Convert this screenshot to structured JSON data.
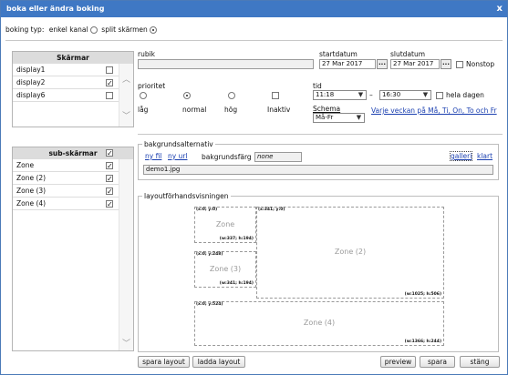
{
  "window": {
    "title": "boka eller ändra boking",
    "close": "x"
  },
  "booking_type": {
    "label": "boking typ:",
    "opt1": "enkel kanal",
    "opt2": "split skärmen"
  },
  "screens": {
    "header": "Skärmar",
    "items": [
      {
        "label": "display1",
        "checked": false
      },
      {
        "label": "display2",
        "checked": true
      },
      {
        "label": "display6",
        "checked": false
      }
    ]
  },
  "subscreens": {
    "header": "sub-skärmar",
    "items": [
      {
        "label": "Zone",
        "checked": true
      },
      {
        "label": "Zone (2)",
        "checked": true
      },
      {
        "label": "Zone (3)",
        "checked": true
      },
      {
        "label": "Zone (4)",
        "checked": true
      }
    ]
  },
  "form": {
    "rubik_label": "rubik",
    "start_label": "startdatum",
    "start_value": "27 Mar 2017",
    "end_label": "slutdatum",
    "end_value": "27 Mar 2017",
    "dots": "...",
    "nonstop": "Nonstop",
    "priority_label": "prioritet",
    "priorities": [
      "låg",
      "normal",
      "hög",
      "Inaktiv"
    ],
    "time_label": "tid",
    "time_from": "11:18",
    "time_dash": "–",
    "time_to": "16:30",
    "whole_day": "hela dagen",
    "schema_label": "Schema",
    "schema_value": "Må-Fr",
    "schema_link": "Varje veckan på Må, Ti, On, To och Fr"
  },
  "background": {
    "legend": "bakgrundsalternativ",
    "new_file": "ny fil",
    "new_url": "ny url",
    "color_label": "bakgrundsfärg",
    "color_value": "none",
    "gallery": "galleri",
    "done": "klart",
    "file_value": "demo1.jpg"
  },
  "preview": {
    "legend": "layoutförhandsvisningen",
    "zones": [
      {
        "name": "Zone",
        "coord": "(x:0; y:0)",
        "size": "(w:337; h:194)"
      },
      {
        "name": "Zone (2)",
        "coord": "(x:341; y:0)",
        "size": "(w:1025; h:506)"
      },
      {
        "name": "Zone (3)",
        "coord": "(x:0; y:248)",
        "size": "(w:341; h:194)"
      },
      {
        "name": "Zone (4)",
        "coord": "(x:0; y:524)",
        "size": "(w:1366; h:244)"
      }
    ]
  },
  "buttons": {
    "save_layout": "spara layout",
    "load_layout": "ladda layout",
    "preview": "preview",
    "save": "spara",
    "close": "stäng"
  },
  "colors": {
    "titlebar": "#3f78c4",
    "link": "#1a3fb0",
    "header_gray": "#dcdcdc"
  }
}
